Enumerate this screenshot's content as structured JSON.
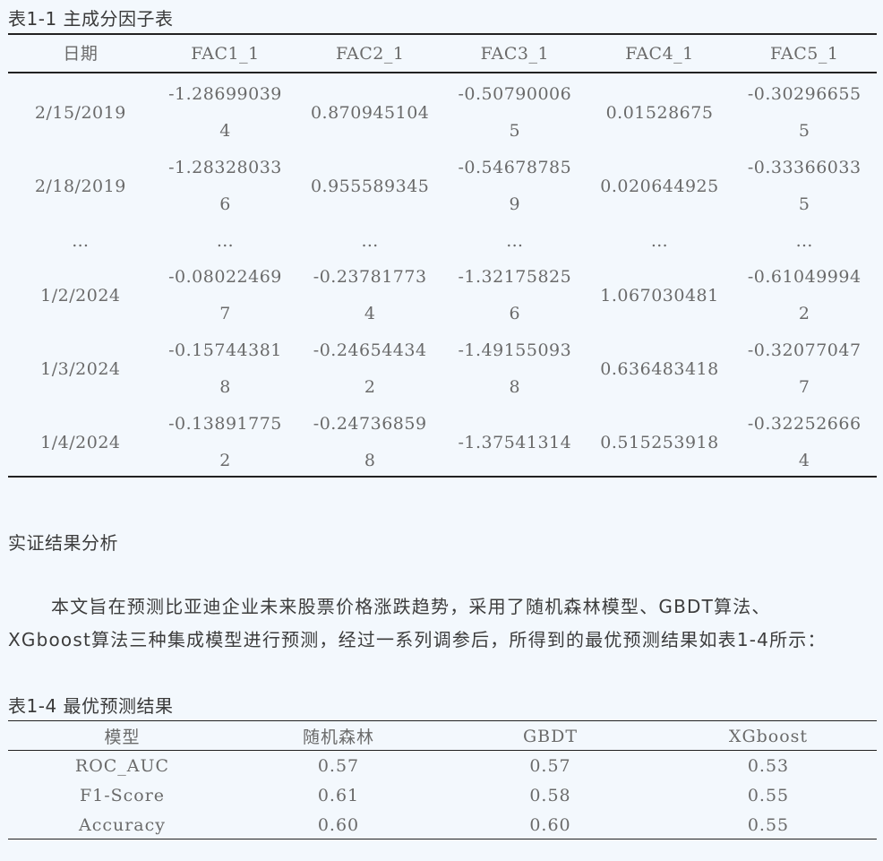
{
  "table1": {
    "caption": "表1-1 主成分因子表",
    "headers": [
      "日期",
      "FAC1_1",
      "FAC2_1",
      "FAC3_1",
      "FAC4_1",
      "FAC5_1"
    ],
    "rows": [
      [
        "2/15/2019",
        "-1.28699039\n4",
        "0.870945104",
        "-0.50790006\n5",
        "0.01528675",
        "-0.30296655\n5"
      ],
      [
        "2/18/2019",
        "-1.28328033\n6",
        "0.955589345",
        "-0.54678785\n9",
        "0.020644925",
        "-0.33366033\n5"
      ],
      [
        "…",
        "…",
        "…",
        "…",
        "…",
        "…"
      ],
      [
        "1/2/2024",
        "-0.08022469\n7",
        "-0.23781773\n4",
        "-1.32175825\n6",
        "1.067030481",
        "-0.61049994\n2"
      ],
      [
        "1/3/2024",
        "-0.15744381\n8",
        "-0.24654434\n2",
        "-1.49155093\n8",
        "0.636483418",
        "-0.32077047\n7"
      ],
      [
        "1/4/2024",
        "-0.13891775\n2",
        "-0.24736859\n8",
        "-1.37541314",
        "0.515253918",
        "-0.32252666\n4"
      ]
    ]
  },
  "section_title": "实证结果分析",
  "paragraph": {
    "line1": "本文旨在预测比亚迪企业未来股票价格涨跌趋势，采用了随机森林模型、GBDT算法、",
    "line2": "XGboost算法三种集成模型进行预测，经过一系列调参后，所得到的最优预测结果如表1-4所示："
  },
  "table4": {
    "caption": "表1-4 最优预测结果",
    "headers": [
      "模型",
      "随机森林",
      "GBDT",
      "XGboost"
    ],
    "rows": [
      [
        "ROC_AUC",
        "0.57",
        "0.57",
        "0.53"
      ],
      [
        "F1-Score",
        "0.61",
        "0.58",
        "0.55"
      ],
      [
        "Accuracy",
        "0.60",
        "0.60",
        "0.55"
      ]
    ]
  }
}
